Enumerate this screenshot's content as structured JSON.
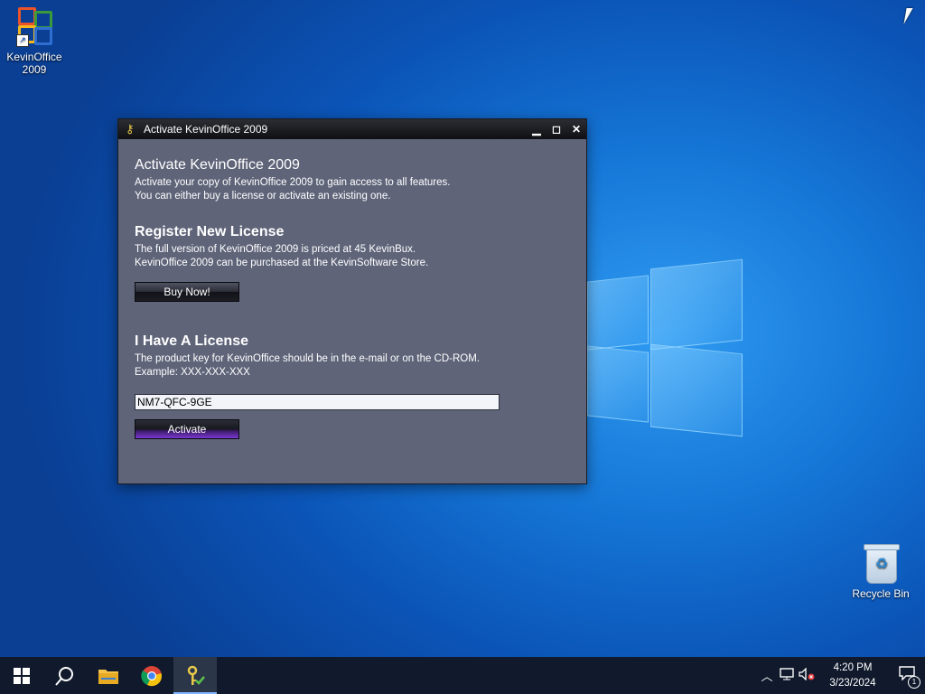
{
  "desktop": {
    "icons": [
      {
        "label_line1": "KevinOffice",
        "label_line2": "2009"
      },
      {
        "label": "Recycle Bin"
      }
    ]
  },
  "dialog": {
    "title": "Activate KevinOffice 2009",
    "heading": "Activate KevinOffice 2009",
    "intro_line1": "Activate your copy of KevinOffice 2009 to gain access to all features.",
    "intro_line2": "You can either buy a license or activate an existing one.",
    "register_heading": "Register New License",
    "register_line1": "The full version of KevinOffice 2009 is priced at 45 KevinBux.",
    "register_line2": "KevinOffice 2009 can be purchased at the KevinSoftware Store.",
    "buy_button": "Buy Now!",
    "license_heading": "I Have A License",
    "license_line1": "The product key for KevinOffice should be in the e-mail or on the CD-ROM.",
    "license_line2": "Example: XXX-XXX-XXX",
    "key_value": "NM7-QFC-9GE",
    "activate_button": "Activate"
  },
  "taskbar": {
    "time": "4:20 PM",
    "date": "3/23/2024",
    "notification_count": "1"
  },
  "icons": [
    "start-icon",
    "search-icon",
    "file-explorer-icon",
    "chrome-icon",
    "key-app-icon",
    "tray-chevron-icon",
    "network-icon",
    "volume-muted-icon",
    "notification-icon"
  ]
}
